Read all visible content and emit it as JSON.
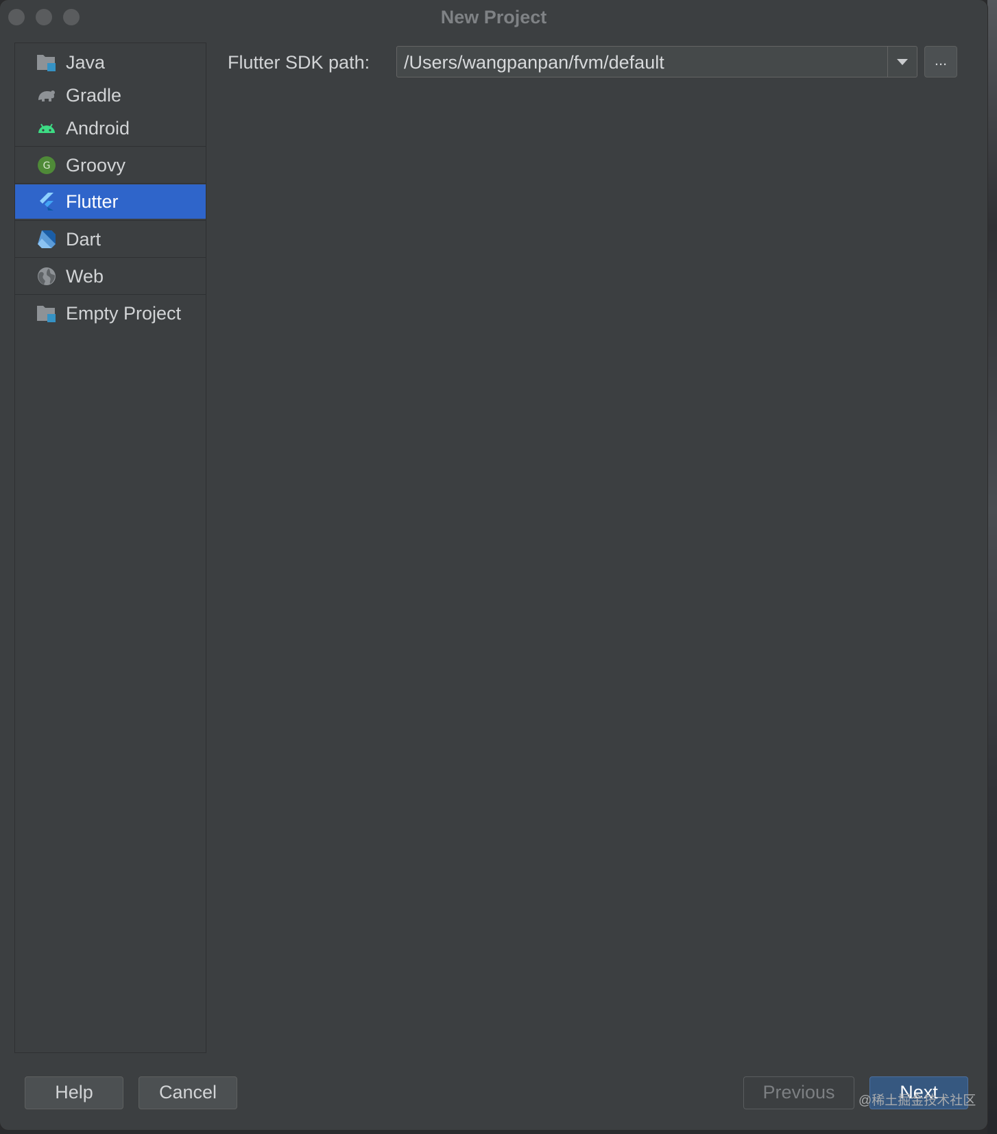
{
  "window": {
    "title": "New Project"
  },
  "sidebar": {
    "items": [
      {
        "label": "Java",
        "icon": "folder-icon"
      },
      {
        "label": "Gradle",
        "icon": "gradle-elephant-icon"
      },
      {
        "label": "Android",
        "icon": "android-icon"
      },
      {
        "label": "Groovy",
        "icon": "groovy-icon"
      },
      {
        "label": "Flutter",
        "icon": "flutter-icon",
        "selected": true
      },
      {
        "label": "Dart",
        "icon": "dart-icon"
      },
      {
        "label": "Web",
        "icon": "globe-icon"
      },
      {
        "label": "Empty Project",
        "icon": "folder-icon"
      }
    ]
  },
  "main": {
    "sdk_label": "Flutter SDK path:",
    "sdk_path": "/Users/wangpanpan/fvm/default",
    "browse_label": "..."
  },
  "footer": {
    "help_label": "Help",
    "cancel_label": "Cancel",
    "previous_label": "Previous",
    "next_label": "Next"
  },
  "watermark": "@稀土掘金技术社区",
  "colors": {
    "window_bg": "#3c3f41",
    "selection": "#2f65ca",
    "primary_button": "#365880",
    "android_green": "#3ddc84",
    "flutter_blue": "#42a5f5"
  }
}
